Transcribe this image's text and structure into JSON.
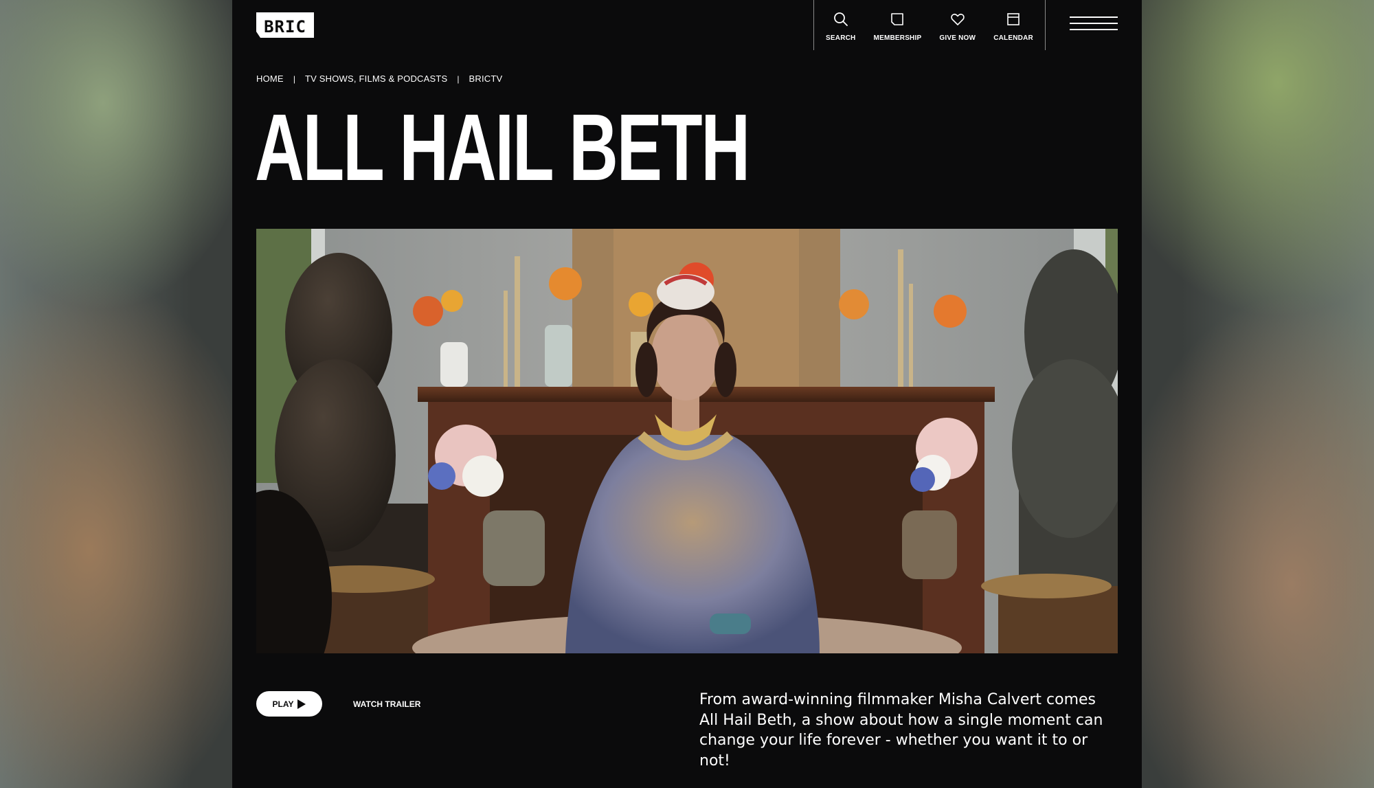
{
  "brand": {
    "logo_text": "BRIC"
  },
  "nav": {
    "items": [
      {
        "label": "SEARCH",
        "icon": "search-icon"
      },
      {
        "label": "MEMBERSHIP",
        "icon": "membership-card-icon"
      },
      {
        "label": "GIVE NOW",
        "icon": "heart-icon"
      },
      {
        "label": "CALENDAR",
        "icon": "calendar-icon"
      }
    ],
    "menu_icon": "hamburger-menu-icon"
  },
  "breadcrumb": {
    "items": [
      "HOME",
      "TV SHOWS, FILMS & PODCASTS",
      "BRICTV"
    ],
    "separator": "|"
  },
  "page": {
    "title": "ALL HAIL BETH"
  },
  "hero": {
    "image_subject": "still-frame-woman-seated-between-lion-statues"
  },
  "actions": {
    "play_label": "PLAY",
    "trailer_label": "WATCH TRAILER"
  },
  "description": "From award-winning filmmaker Misha Calvert comes All Hail Beth, a show about how a single moment can change your life forever - whether you want it to or not!",
  "colors": {
    "page_background": "#0b0b0c",
    "text": "#ffffff",
    "button_background": "#ffffff"
  }
}
